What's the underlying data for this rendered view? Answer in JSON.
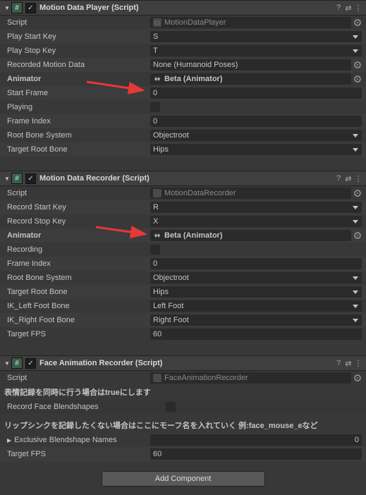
{
  "components": [
    {
      "title": "Motion Data Player (Script)",
      "checked": true,
      "script": "MotionDataPlayer",
      "fields": {
        "play_start_key_label": "Play Start Key",
        "play_start_key": "S",
        "play_stop_key_label": "Play Stop Key",
        "play_stop_key": "T",
        "recorded_motion_label": "Recorded Motion Data",
        "recorded_motion": "None (Humanoid Poses)",
        "animator_label": "Animator",
        "animator": "Beta (Animator)",
        "start_frame_label": "Start Frame",
        "start_frame": "0",
        "playing_label": "Playing",
        "frame_index_label": "Frame Index",
        "frame_index": "0",
        "root_bone_system_label": "Root Bone System",
        "root_bone_system": "Objectroot",
        "target_root_bone_label": "Target Root Bone",
        "target_root_bone": "Hips"
      }
    },
    {
      "title": "Motion Data Recorder (Script)",
      "checked": true,
      "script": "MotionDataRecorder",
      "fields": {
        "record_start_key_label": "Record Start Key",
        "record_start_key": "R",
        "record_stop_key_label": "Record Stop Key",
        "record_stop_key": "X",
        "animator_label": "Animator",
        "animator": "Beta (Animator)",
        "recording_label": "Recording",
        "frame_index_label": "Frame Index",
        "frame_index": "0",
        "root_bone_system_label": "Root Bone System",
        "root_bone_system": "Objectroot",
        "target_root_bone_label": "Target Root Bone",
        "target_root_bone": "Hips",
        "ik_left_label": "IK_Left Foot Bone",
        "ik_left": "Left Foot",
        "ik_right_label": "IK_Right Foot Bone",
        "ik_right": "Right Foot",
        "target_fps_label": "Target FPS",
        "target_fps": "60"
      }
    },
    {
      "title": "Face Animation Recorder (Script)",
      "checked": true,
      "script": "FaceAnimationRecorder",
      "notes": {
        "blendshapes_hint": "表情記録を同時に行う場合はtrueにします",
        "record_blendshapes_label": "Record Face Blendshapes",
        "exclusive_hint": "リップシンクを記録したくない場合はここにモーフ名を入れていく 例:face_mouse_eなど",
        "exclusive_label": "Exclusive Blendshape Names",
        "exclusive_count": "0",
        "target_fps_label": "Target FPS",
        "target_fps": "60"
      }
    }
  ],
  "script_label": "Script",
  "add_component": "Add Component"
}
